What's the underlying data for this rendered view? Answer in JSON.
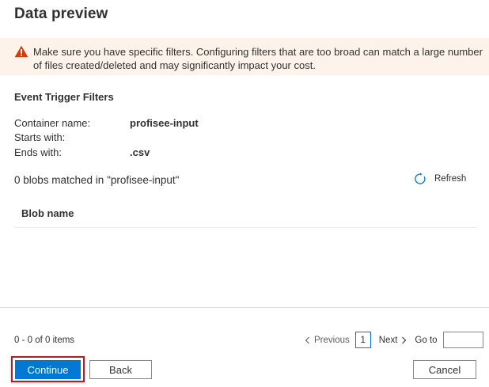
{
  "page": {
    "title": "Data preview"
  },
  "warning": {
    "icon": "warning-triangle-icon",
    "color": "#d83b01",
    "text": "Make sure you have specific filters. Configuring filters that are too broad can match a large number of files created/deleted and may significantly impact your cost."
  },
  "filters": {
    "title": "Event Trigger Filters",
    "container_label": "Container name:",
    "container_value": "profisee-input",
    "starts_label": "Starts with:",
    "starts_value": "",
    "ends_label": "Ends with:",
    "ends_value": ".csv"
  },
  "results": {
    "matched_text": "0 blobs matched in \"profisee-input\"",
    "refresh_label": "Refresh",
    "columns": [
      "Blob name"
    ],
    "rows": []
  },
  "pagination": {
    "items_text": "0 - 0 of 0 items",
    "previous_label": "Previous",
    "current_page": "1",
    "next_label": "Next",
    "goto_label": "Go to",
    "goto_value": ""
  },
  "buttons": {
    "continue_label": "Continue",
    "back_label": "Back",
    "cancel_label": "Cancel"
  },
  "colors": {
    "accent": "#0078d4",
    "focus_outline": "#a4262c",
    "warning_bg": "#fdf3ea"
  }
}
